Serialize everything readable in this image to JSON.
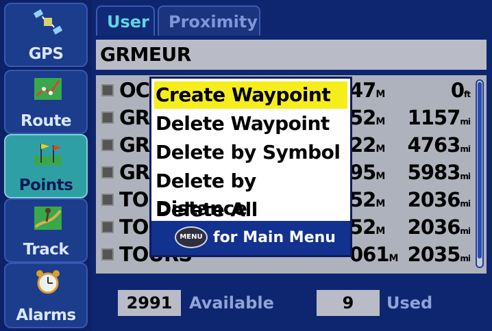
{
  "sidebar": {
    "items": [
      {
        "label": "GPS",
        "icon": "satellite-icon",
        "active": false
      },
      {
        "label": "Route",
        "icon": "route-map-icon",
        "active": false
      },
      {
        "label": "Points",
        "icon": "flags-icon",
        "active": true
      },
      {
        "label": "Track",
        "icon": "hiker-icon",
        "active": false
      },
      {
        "label": "Alarms",
        "icon": "alarm-clock-icon",
        "active": false
      }
    ]
  },
  "tabs": [
    {
      "label": "User",
      "active": true
    },
    {
      "label": "Proximity",
      "active": false
    }
  ],
  "name_field": {
    "value": "GRMEUR"
  },
  "waypoints": [
    {
      "name": "OC",
      "bearing": "47",
      "bearing_unit": "M",
      "distance": "0",
      "distance_unit": "ft"
    },
    {
      "name": "GR",
      "bearing": "52",
      "bearing_unit": "M",
      "distance": "1157",
      "distance_unit": "mi"
    },
    {
      "name": "GR",
      "bearing": "22",
      "bearing_unit": "M",
      "distance": "4763",
      "distance_unit": "mi"
    },
    {
      "name": "GR",
      "bearing": "95",
      "bearing_unit": "M",
      "distance": "5983",
      "distance_unit": "mi"
    },
    {
      "name": "TO",
      "bearing": "52",
      "bearing_unit": "M",
      "distance": "2036",
      "distance_unit": "mi"
    },
    {
      "name": "TO",
      "bearing": "52",
      "bearing_unit": "M",
      "distance": "2036",
      "distance_unit": "mi"
    },
    {
      "name": "TOURS",
      "bearing": "061",
      "bearing_unit": "M",
      "distance": "2035",
      "distance_unit": "mi"
    }
  ],
  "footer": {
    "available_count": "2991",
    "available_label": "Available",
    "used_count": "9",
    "used_label": "Used"
  },
  "menu": {
    "items": [
      {
        "label": "Create Waypoint",
        "selected": true
      },
      {
        "label": "Delete Waypoint",
        "selected": false
      },
      {
        "label": "Delete by Symbol",
        "selected": false
      },
      {
        "label": "Delete by Distance",
        "selected": false
      },
      {
        "label": "Delete All",
        "selected": false
      }
    ],
    "footer_button": "MENU",
    "footer_text": "for Main Menu"
  },
  "colors": {
    "background": "#0a1a55",
    "active_tab": "#2f9fa6",
    "highlight": "#f6ee1c",
    "menu_footer": "#13318e"
  }
}
